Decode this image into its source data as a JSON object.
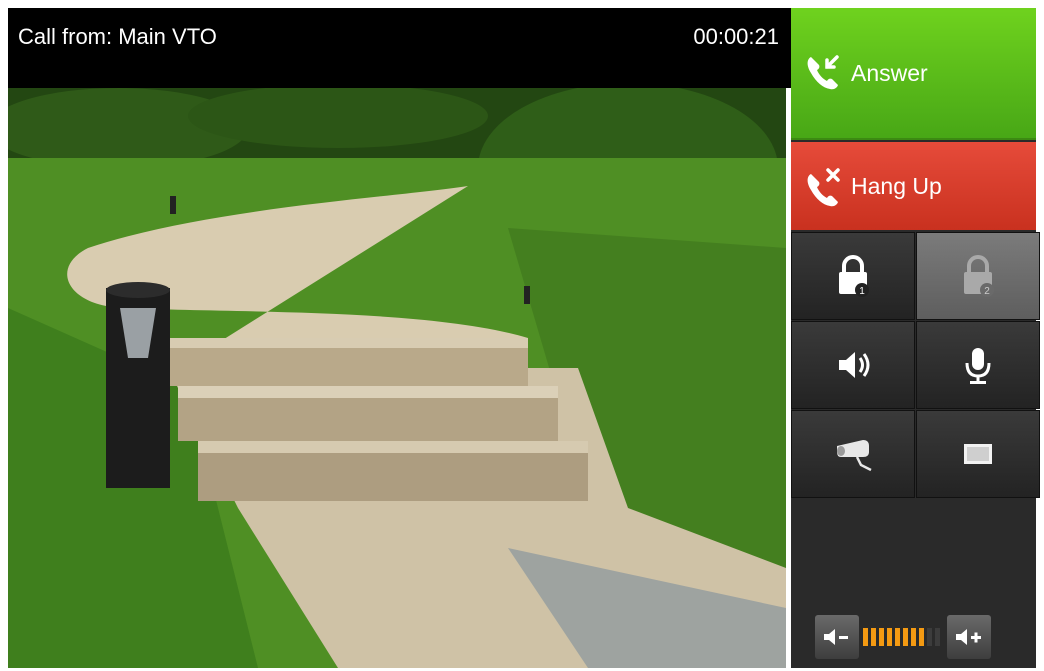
{
  "call": {
    "caller_label": "Call from: Main VTO",
    "timer": "00:00:21"
  },
  "buttons": {
    "answer_label": "Answer",
    "hangup_label": "Hang Up"
  },
  "grid": [
    {
      "name": "unlock-door-1-button",
      "icon": "lock-1-icon",
      "state": "active"
    },
    {
      "name": "unlock-door-2-button",
      "icon": "lock-2-icon",
      "state": "disabled"
    },
    {
      "name": "speaker-button",
      "icon": "speaker-icon"
    },
    {
      "name": "microphone-button",
      "icon": "microphone-icon"
    },
    {
      "name": "camera-button",
      "icon": "security-camera-icon"
    },
    {
      "name": "screen-button",
      "icon": "screen-icon"
    }
  ],
  "volume": {
    "level": 8,
    "max": 10
  },
  "colors": {
    "answer": "#58b91a",
    "hangup": "#d63b29",
    "volume_active": "#f49a12",
    "panel": "#2a2a2a"
  }
}
